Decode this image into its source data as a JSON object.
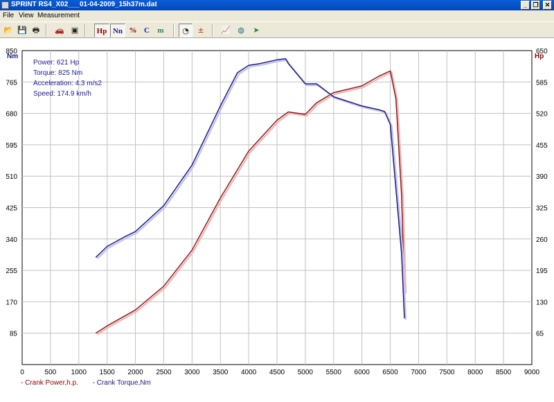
{
  "window": {
    "title": "SPRINT  RS4_X02___01-04-2009_15h37m.dat",
    "minimize": "_",
    "restore": "❐",
    "close": "✕"
  },
  "menu": [
    {
      "label": "File"
    },
    {
      "label": "View"
    },
    {
      "label": "Measurement"
    }
  ],
  "toolbar": {
    "hp": "Hp",
    "nm": "Nn",
    "pct": "%",
    "c": "C",
    "m": "m"
  },
  "info": {
    "power": "Power: 621 Hp",
    "torque": "Torque: 825 Nm",
    "acceleration": "Acceleration: 4.3 m/s2",
    "speed": "Speed: 174.9 km/h"
  },
  "legend": {
    "power": "- Crank Power,h.p.",
    "torque": "- Crank Torque,Nm"
  },
  "colors": {
    "power": "#8b1a1a",
    "torque": "#1a1a80",
    "grid": "#c0c0c0"
  },
  "chart_data": {
    "type": "line",
    "xlim": [
      0,
      9000
    ],
    "x_ticks": [
      0,
      500,
      1000,
      1500,
      2000,
      2500,
      3000,
      3500,
      4000,
      4500,
      5000,
      5500,
      6000,
      6500,
      7000,
      7500,
      8000,
      8500,
      9000
    ],
    "y_left": {
      "unit": "Nm",
      "ticks": [
        85,
        170,
        255,
        340,
        425,
        510,
        595,
        680,
        765,
        850
      ],
      "range": [
        0,
        850
      ]
    },
    "y_right": {
      "unit": "Hp",
      "ticks": [
        65,
        130,
        195,
        260,
        325,
        390,
        455,
        520,
        585,
        650
      ],
      "range": [
        0,
        650
      ]
    },
    "grid": true,
    "series": [
      {
        "name": "Crank Power,h.p.",
        "axis": "right",
        "x": [
          1300,
          1500,
          2000,
          2500,
          3000,
          3500,
          4000,
          4500,
          4700,
          5000,
          5200,
          5500,
          6000,
          6300,
          6500,
          6600,
          6700,
          6750
        ],
        "y": [
          65,
          80,
          113,
          162,
          237,
          345,
          442,
          506,
          523,
          518,
          542,
          563,
          577,
          597,
          608,
          550,
          350,
          150
        ]
      },
      {
        "name": "Crank Torque,Nm",
        "axis": "left",
        "x": [
          1300,
          1500,
          1800,
          2000,
          2500,
          3000,
          3500,
          3800,
          4000,
          4200,
          4500,
          4650,
          4700,
          5000,
          5200,
          5500,
          6000,
          6300,
          6400,
          6500,
          6700,
          6750
        ],
        "y": [
          290,
          320,
          345,
          360,
          430,
          540,
          700,
          790,
          810,
          815,
          825,
          828,
          815,
          760,
          760,
          725,
          700,
          690,
          685,
          650,
          300,
          125
        ]
      }
    ]
  }
}
